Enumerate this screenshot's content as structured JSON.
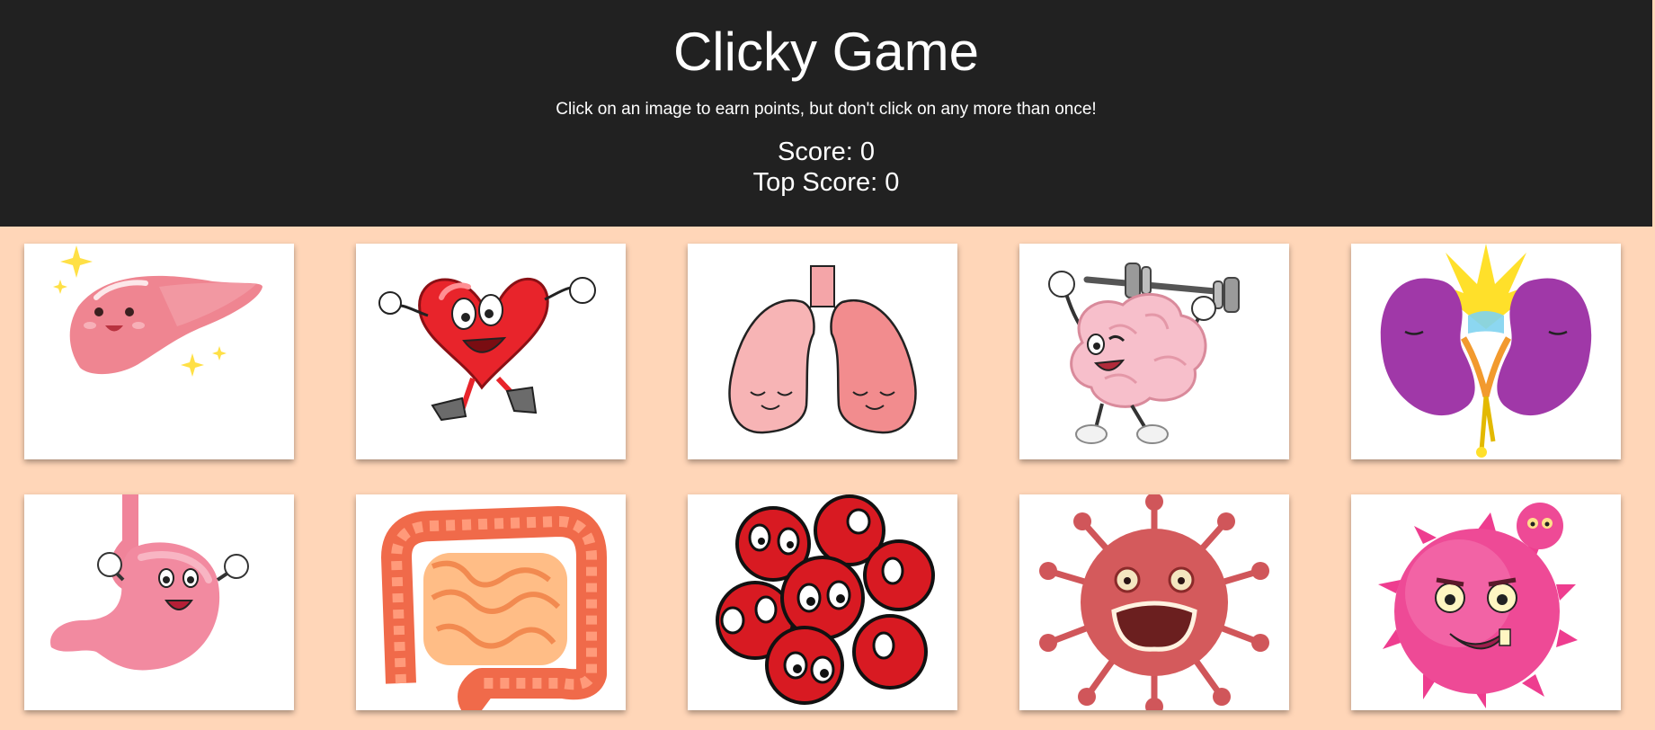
{
  "header": {
    "title": "Clicky Game",
    "instructions": "Click on an image to earn points, but don't click on any more than once!",
    "score_label": "Score: 0",
    "top_score_label": "Top Score: 0",
    "score": 0,
    "top_score": 0
  },
  "colors": {
    "header_bg": "#212121",
    "page_bg": "#ffd6b8",
    "card_bg": "#ffffff"
  },
  "cards": [
    {
      "id": "liver",
      "icon": "liver-icon"
    },
    {
      "id": "heart",
      "icon": "heart-icon"
    },
    {
      "id": "lungs",
      "icon": "lungs-icon"
    },
    {
      "id": "brain",
      "icon": "brain-icon"
    },
    {
      "id": "kidneys",
      "icon": "kidneys-icon"
    },
    {
      "id": "stomach",
      "icon": "stomach-icon"
    },
    {
      "id": "intestines",
      "icon": "intestines-icon"
    },
    {
      "id": "blood-cells",
      "icon": "blood-cells-icon"
    },
    {
      "id": "virus-red",
      "icon": "virus-icon"
    },
    {
      "id": "germ-pink",
      "icon": "germ-icon"
    }
  ]
}
